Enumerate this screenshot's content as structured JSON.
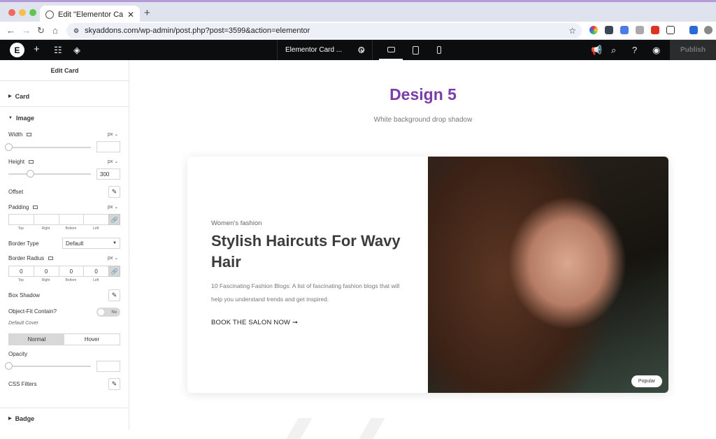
{
  "browser": {
    "tab_title": "Edit \"Elementor Card Widget\"",
    "url": "skyaddons.com/wp-admin/post.php?post=3599&action=elementor"
  },
  "editor": {
    "document_title": "Elementor Card ...",
    "publish_label": "Publish"
  },
  "panel": {
    "title": "Edit Card",
    "sections": {
      "card": "Card",
      "image": "Image",
      "badge": "Badge"
    },
    "width": {
      "label": "Width",
      "unit": "px",
      "value": "",
      "slider": 0.0
    },
    "height": {
      "label": "Height",
      "unit": "px",
      "value": "300",
      "slider": 0.27
    },
    "offset_label": "Offset",
    "padding": {
      "label": "Padding",
      "unit": "px",
      "values": [
        "",
        "",
        "",
        ""
      ],
      "sides": [
        "Top",
        "Right",
        "Bottom",
        "Left"
      ]
    },
    "border_type": {
      "label": "Border Type",
      "value": "Default"
    },
    "border_radius": {
      "label": "Border Radius",
      "unit": "px",
      "values": [
        "0",
        "0",
        "0",
        "0"
      ],
      "sides": [
        "Top",
        "Right",
        "Bottom",
        "Left"
      ]
    },
    "box_shadow_label": "Box Shadow",
    "object_fit": {
      "label": "Object-Fit Contain?",
      "toggle": "No",
      "note": "Default Cover"
    },
    "state_tabs": [
      "Normal",
      "Hover"
    ],
    "opacity": {
      "label": "Opacity",
      "value": "",
      "slider": 0.0
    },
    "css_filters_label": "CSS Filters"
  },
  "canvas": {
    "heading": "Design 5",
    "subheading": "White background drop shadow",
    "card": {
      "category": "Women's fashion",
      "title": "Stylish Haircuts For Wavy Hair",
      "description": "10 Fascinating Fashion Blogs: A list of fascinating fashion blogs that will help you understand trends and get inspired.",
      "cta": "BOOK THE SALON NOW ➞",
      "badge": "Popular"
    }
  },
  "colors": {
    "heading_purple": "#7b3ea8",
    "editor_bar": "#0c0d0e"
  }
}
